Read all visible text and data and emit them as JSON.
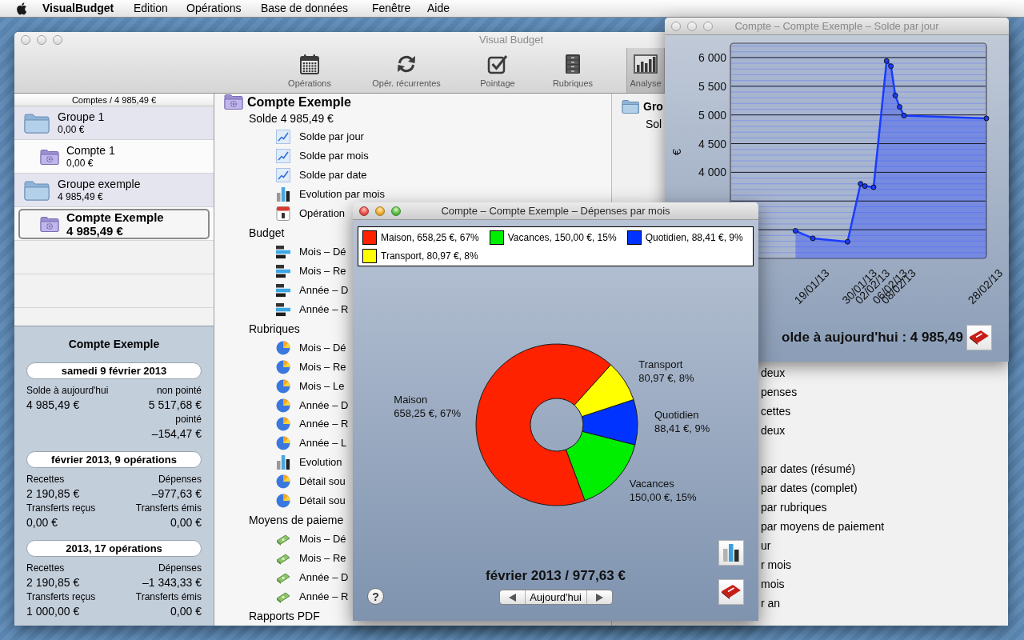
{
  "menu_bar": {
    "app_name": "VisualBudget",
    "menus": [
      "Edition",
      "Opérations",
      "Base de données",
      "Fenêtre",
      "Aide"
    ]
  },
  "main_window": {
    "title": "Visual Budget",
    "active": false,
    "toolbar": [
      {
        "label": "Opérations",
        "kind": "calendar",
        "selected": false
      },
      {
        "label": "Opér. récurrentes",
        "kind": "cycle",
        "selected": false
      },
      {
        "label": "Pointage",
        "kind": "check",
        "selected": false
      },
      {
        "label": "Rubriques",
        "kind": "cabinet",
        "selected": false
      },
      {
        "label": "Analyse",
        "kind": "chart",
        "selected": true
      }
    ],
    "accounts": {
      "header": "Comptes / 4 985,49 €",
      "groups": [
        {
          "name": "Groupe 1",
          "amount": "0,00 €",
          "selected": false,
          "children": [
            {
              "name": "Compte 1",
              "amount": "0,00 €",
              "selected": false
            }
          ]
        },
        {
          "name": "Groupe exemple",
          "amount": "4 985,49 €",
          "selected": false,
          "children": [
            {
              "name": "Compte Exemple",
              "amount": "4 985,49 €",
              "selected": true
            }
          ]
        }
      ]
    },
    "summary": {
      "title": "Compte Exemple",
      "blocks": [
        {
          "heading": "samedi 9 février 2013",
          "rows": [
            {
              "kind": "label",
              "left": "Solde à aujourd'hui",
              "right": "non pointé"
            },
            {
              "kind": "value",
              "left": "4 985,49 €",
              "right": "5 517,68 €"
            },
            {
              "kind": "label",
              "right": "pointé"
            },
            {
              "kind": "value",
              "right": "–154,47 €"
            }
          ]
        },
        {
          "heading": "février 2013, 9 opérations",
          "rows": [
            {
              "kind": "label",
              "left": "Recettes",
              "right": "Dépenses"
            },
            {
              "kind": "value",
              "left": "2 190,85 €",
              "right": "–977,63 €"
            },
            {
              "kind": "label",
              "left": "Transferts reçus",
              "right": "Transferts émis"
            },
            {
              "kind": "value",
              "left": "0,00 €",
              "right": "0,00 €"
            }
          ]
        },
        {
          "heading": "2013, 17 opérations",
          "rows": [
            {
              "kind": "label",
              "left": "Recettes",
              "right": "Dépenses"
            },
            {
              "kind": "value",
              "left": "2 190,85 €",
              "right": "–1 343,33 €"
            },
            {
              "kind": "label",
              "left": "Transferts reçus",
              "right": "Transferts émis"
            },
            {
              "kind": "value",
              "left": "1 000,00 €",
              "right": "0,00 €"
            }
          ]
        }
      ]
    },
    "report_list": {
      "title": "Compte Exemple",
      "balance": "Solde 4 985,49 €",
      "sections": [
        {
          "items": [
            {
              "kind": "line",
              "label": "Solde par jour"
            },
            {
              "kind": "line",
              "label": "Solde par mois"
            },
            {
              "kind": "line",
              "label": "Solde par date"
            },
            {
              "kind": "bars",
              "label": "Evolution par mois"
            },
            {
              "kind": "calendar",
              "label": "Opération"
            }
          ]
        },
        {
          "title": "Budget",
          "items": [
            {
              "kind": "budget",
              "label": "Mois – Dé"
            },
            {
              "kind": "budget",
              "label": "Mois – Re"
            },
            {
              "kind": "budget",
              "label": "Année – D"
            },
            {
              "kind": "budget",
              "label": "Année – R"
            }
          ]
        },
        {
          "title": "Rubriques",
          "items": [
            {
              "kind": "pie",
              "label": "Mois – Dé"
            },
            {
              "kind": "pie",
              "label": "Mois – Re"
            },
            {
              "kind": "pie",
              "label": "Mois – Le"
            },
            {
              "kind": "pie",
              "label": "Année – D"
            },
            {
              "kind": "pie",
              "label": "Année – R"
            },
            {
              "kind": "pie",
              "label": "Année – L"
            },
            {
              "kind": "bars",
              "label": "Evolution"
            },
            {
              "kind": "pie",
              "label": "Détail sou"
            },
            {
              "kind": "pie",
              "label": "Détail sou"
            }
          ]
        },
        {
          "title": "Moyens de paieme",
          "items": [
            {
              "kind": "money",
              "label": "Mois – Dé"
            },
            {
              "kind": "money",
              "label": "Mois – Re"
            },
            {
              "kind": "money",
              "label": "Année – D"
            },
            {
              "kind": "money",
              "label": "Année – R"
            }
          ]
        },
        {
          "title": "Rapports PDF"
        }
      ]
    },
    "group_list": {
      "title": "Gro",
      "balance": "Sol",
      "sections": [
        {
          "items": [
            {
              "label": "deux"
            },
            {
              "label": "penses"
            },
            {
              "label": "cettes"
            },
            {
              "label": "deux"
            }
          ]
        },
        {
          "items": [
            {
              "label": "par dates (résumé)"
            },
            {
              "label": "par dates (complet)"
            },
            {
              "label": "par rubriques"
            },
            {
              "label": "par moyens de paiement"
            },
            {
              "label": "ur"
            },
            {
              "label": "r mois"
            },
            {
              "label": "mois"
            },
            {
              "label": "r an"
            }
          ]
        }
      ]
    }
  },
  "chart_window": {
    "title": "Compte – Compte Exemple – Solde par jour",
    "active": false,
    "chart_data": {
      "type": "area",
      "ylabel": "€",
      "grid": true,
      "categories": [
        null,
        null,
        null,
        null,
        null,
        null,
        null,
        null,
        null,
        null,
        null,
        null,
        null,
        null,
        null,
        null,
        null,
        null,
        null,
        "19/01/13",
        null,
        null,
        null,
        null,
        null,
        null,
        null,
        null,
        null,
        null,
        "30/01/13",
        null,
        null,
        "02/02/13",
        null,
        null,
        null,
        "06/02/13",
        null,
        "08/02/13",
        null,
        null,
        null,
        null,
        null,
        null,
        null,
        null,
        null,
        null,
        null,
        null,
        null,
        null,
        null,
        null,
        null,
        null,
        null,
        "28/02/13"
      ],
      "series": [
        {
          "color": "#1a3cff",
          "values": [
            null,
            null,
            null,
            null,
            null,
            null,
            null,
            null,
            null,
            null,
            null,
            null,
            null,
            null,
            null,
            2980,
            null,
            null,
            null,
            2850,
            null,
            null,
            null,
            null,
            null,
            null,
            null,
            2790,
            null,
            null,
            3800,
            3760,
            null,
            3740,
            null,
            null,
            5940,
            5850,
            5340,
            5140,
            4990,
            null,
            null,
            null,
            null,
            null,
            null,
            null,
            null,
            null,
            null,
            null,
            null,
            null,
            null,
            null,
            null,
            null,
            null,
            4940
          ]
        }
      ],
      "ylim": [
        2500,
        6250
      ],
      "yticks": [
        {
          "value": 4000,
          "label": "4 000"
        },
        {
          "value": 4500,
          "label": "4 500"
        },
        {
          "value": 5000,
          "label": "5 000"
        },
        {
          "value": 5500,
          "label": "5 500"
        },
        {
          "value": 6000,
          "label": "6 000"
        }
      ]
    },
    "footer": "olde à aujourd'hui : 4 985,49"
  },
  "pie_window": {
    "title": "Compte – Compte Exemple – Dépenses par mois",
    "active": true,
    "legend": [
      {
        "label": "Maison, 658,25 €, 67%",
        "color": "#ff2200"
      },
      {
        "label": "Vacances, 150,00 €, 15%",
        "color": "#00ee00"
      },
      {
        "label": "Quotidien, 88,41 €, 9%",
        "color": "#0033ff"
      },
      {
        "label": "Transport, 80,97 €, 8%",
        "color": "#ffff00"
      }
    ],
    "chart_data": {
      "type": "donut",
      "categories": [
        "Maison",
        "Vacances",
        "Quotidien",
        "Transport"
      ],
      "values": [
        658.25,
        150.0,
        88.41,
        80.97
      ],
      "value_labels": [
        "658,25 €, 67%",
        "150,00 €, 15%",
        "88,41 €, 9%",
        "80,97 €, 8%"
      ]
    },
    "period": "février 2013 / 977,63 €",
    "navigator": {
      "label": "Aujourd'hui"
    },
    "help": "?"
  }
}
